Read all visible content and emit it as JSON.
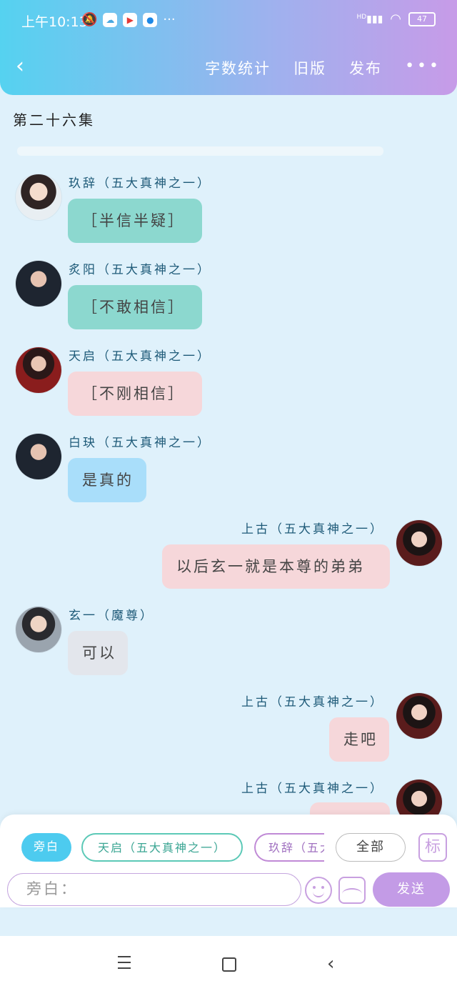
{
  "status": {
    "time": "上午10:13",
    "more": "···",
    "battery": "47",
    "network": "HD"
  },
  "nav": {
    "word_count": "字数统计",
    "old_version": "旧版",
    "publish": "发布",
    "more": "•••"
  },
  "episode_title": "第二十六集",
  "messages": [
    {
      "name": "玖辞（五大真神之一）",
      "text": "［半信半疑］"
    },
    {
      "name": "炙阳（五大真神之一）",
      "text": "［不敢相信］"
    },
    {
      "name": "天启（五大真神之一）",
      "text": "［不刚相信］"
    },
    {
      "name": "白玦（五大真神之一）",
      "text": "是真的"
    },
    {
      "name": "上古（五大真神之一）",
      "text": "以后玄一就是本尊的弟弟"
    },
    {
      "name": "玄一（魔尊）",
      "text": "可以"
    },
    {
      "name": "上古（五大真神之一）",
      "text": "走吧"
    },
    {
      "name": "上古（五大真神之一）",
      "text": ""
    }
  ],
  "composer": {
    "chips": [
      "旁白",
      "天启（五大真神之一）",
      "玖辞（五大真神之一）",
      "全部"
    ],
    "mark": "标",
    "input_placeholder": "旁白：",
    "send": "发送"
  }
}
